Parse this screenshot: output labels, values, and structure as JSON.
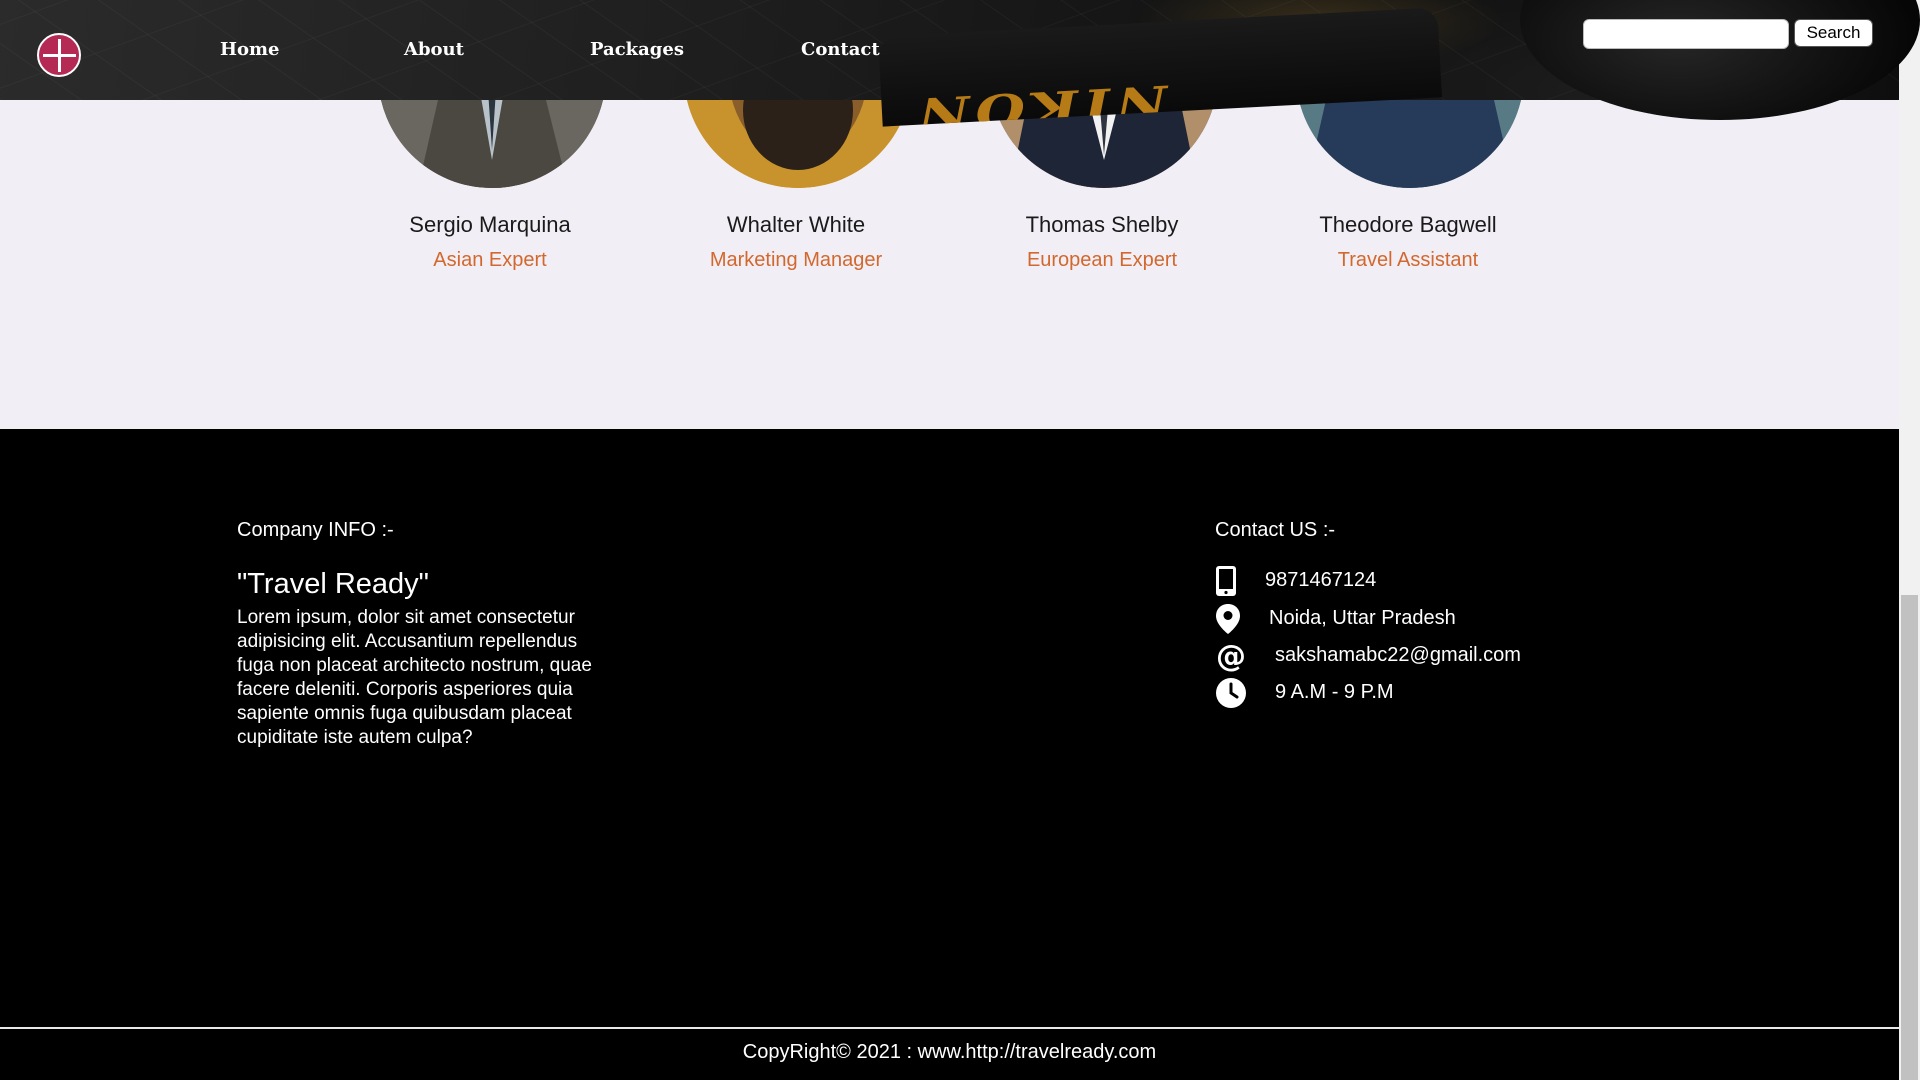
{
  "nav": {
    "logo": "cross-globe-logo",
    "links": [
      "Home",
      "About",
      "Packages",
      "Contact"
    ],
    "search_placeholder": "",
    "search_label": "Search",
    "background_text": "NIKON"
  },
  "team": [
    {
      "name": "Sergio Marquina",
      "role": "Asian Expert"
    },
    {
      "name": "Whalter White",
      "role": "Marketing Manager"
    },
    {
      "name": "Thomas Shelby",
      "role": "European Expert"
    },
    {
      "name": "Theodore Bagwell",
      "role": "Travel Assistant"
    }
  ],
  "footer": {
    "company_heading": "Company INFO :-",
    "brand": "\"Travel Ready\"",
    "description": "Lorem ipsum, dolor sit amet consectetur adipisicing elit. Accusantium repellendus fuga non placeat architecto nostrum, quae facere deleniti. Corporis asperiores quia sapiente omnis fuga quibusdam placeat cupiditate iste autem culpa?",
    "contact_heading": "Contact US :-",
    "phone": "9871467124",
    "location": "Noida, Uttar Pradesh",
    "email": "sakshamabc22@gmail.com",
    "hours": "9 A.M - 9 P.M",
    "copyright": "CopyRight© 2021 : www.http://travelready.com"
  },
  "colors": {
    "accent": "#d2682e",
    "page_bg": "#f2eef5",
    "footer_bg": "#000000",
    "logo": "#b42a55"
  }
}
